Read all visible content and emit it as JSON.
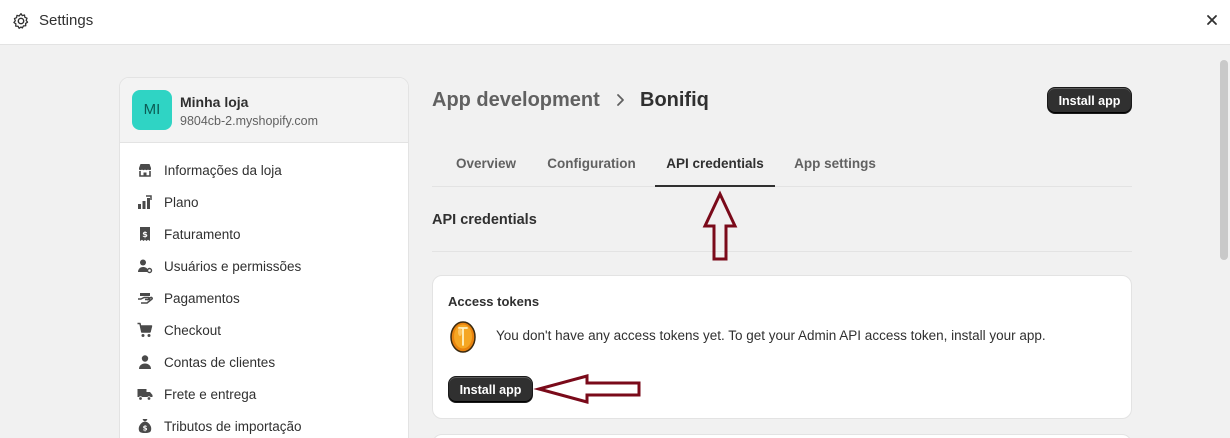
{
  "window": {
    "title": "Settings"
  },
  "store": {
    "initials": "MI",
    "name": "Minha loja",
    "domain": "9804cb-2.myshopify.com"
  },
  "sidebar": {
    "items": [
      {
        "label": "Informações da loja",
        "icon": "store-icon"
      },
      {
        "label": "Plano",
        "icon": "plan-chart-icon"
      },
      {
        "label": "Faturamento",
        "icon": "receipt-icon"
      },
      {
        "label": "Usuários e permissões",
        "icon": "user-gear-icon"
      },
      {
        "label": "Pagamentos",
        "icon": "payment-hand-icon"
      },
      {
        "label": "Checkout",
        "icon": "cart-icon"
      },
      {
        "label": "Contas de clientes",
        "icon": "person-icon"
      },
      {
        "label": "Frete e entrega",
        "icon": "truck-icon"
      },
      {
        "label": "Tributos de importação",
        "icon": "money-bag-icon"
      }
    ]
  },
  "header": {
    "breadcrumb_parent": "App development",
    "breadcrumb_current": "Bonifiq",
    "install_button": "Install app"
  },
  "tabs": [
    {
      "label": "Overview",
      "active": false
    },
    {
      "label": "Configuration",
      "active": false
    },
    {
      "label": "API credentials",
      "active": true
    },
    {
      "label": "App settings",
      "active": false
    }
  ],
  "section": {
    "title": "API credentials"
  },
  "access_tokens": {
    "title": "Access tokens",
    "icon": "coin-icon",
    "message": "You don't have any access tokens yet. To get your Admin API access token, install your app.",
    "install_button": "Install app"
  },
  "colors": {
    "annotation_arrow": "#7a0a1a",
    "avatar": "#2fd4c4",
    "primary_button": "#303030"
  }
}
